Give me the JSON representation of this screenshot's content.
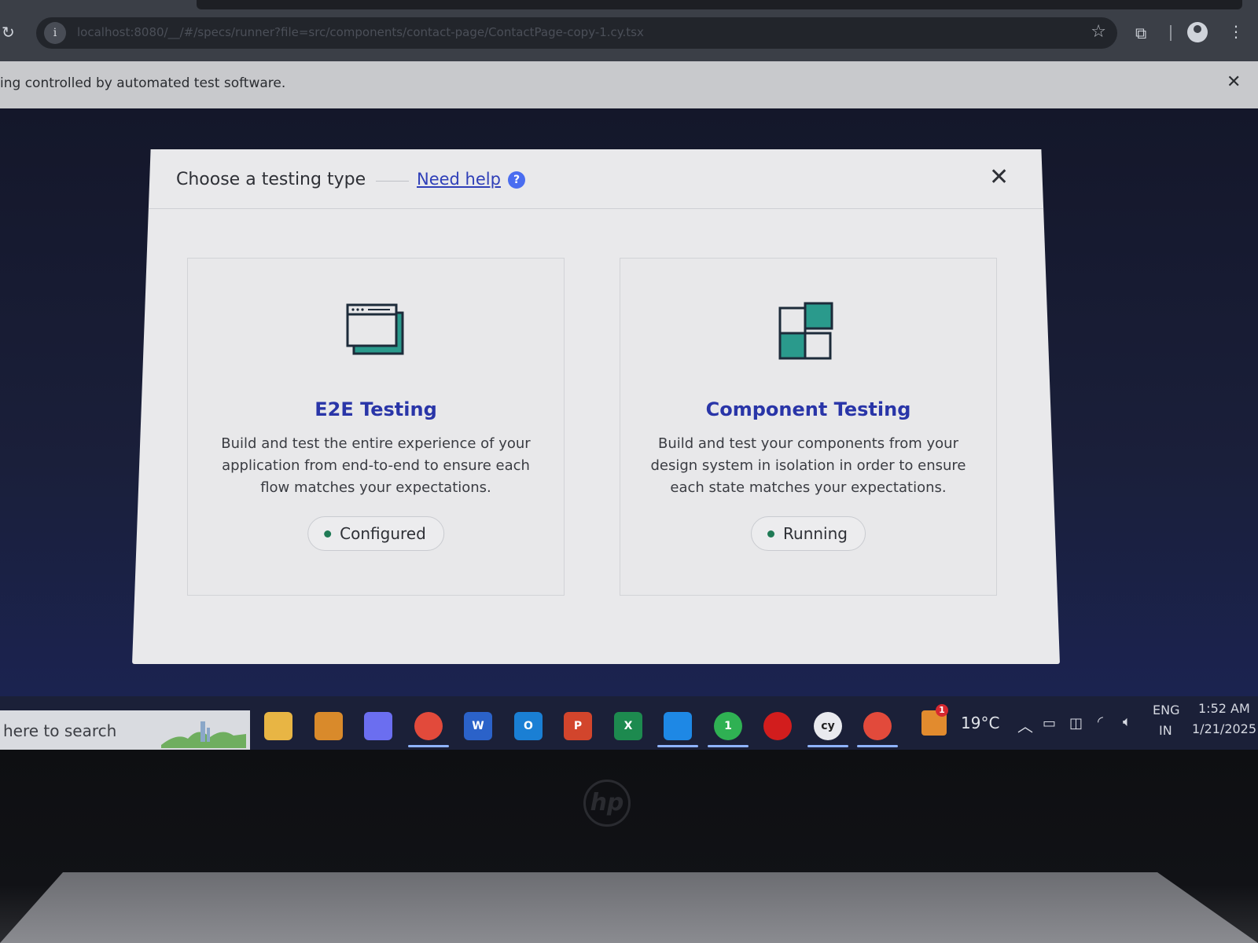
{
  "browser": {
    "url": "localhost:8080/__/#/specs/runner?file=src/components/contact-page/ContactPage-copy-1.cy.tsx",
    "automation_notice": "ing controlled by automated test software.",
    "automation_close": "✕"
  },
  "modal": {
    "title": "Choose a testing type",
    "help_link": "Need help",
    "help_icon_glyph": "?",
    "close_glyph": "✕",
    "cards": [
      {
        "title": "E2E Testing",
        "description": "Build and test the entire experience of your application from end-to-end to ensure each flow matches your expectations.",
        "status": "Configured",
        "icon": "browser-window-icon"
      },
      {
        "title": "Component Testing",
        "description": "Build and test your components from your design system in isolation in order to ensure each state matches your expectations.",
        "status": "Running",
        "icon": "component-blocks-icon"
      }
    ]
  },
  "taskbar": {
    "search_text": "here to search",
    "apps": [
      {
        "name": "file-explorer-icon",
        "label": "",
        "color": "#e8b544"
      },
      {
        "name": "notes-app-icon",
        "label": "",
        "color": "#d98a2b"
      },
      {
        "name": "copilot-icon",
        "label": "",
        "color": "#6b6ef0"
      },
      {
        "name": "chrome-icon",
        "label": "",
        "color": "#e24a3b"
      },
      {
        "name": "word-icon",
        "label": "W",
        "color": "#2b62c9"
      },
      {
        "name": "outlook-icon",
        "label": "O",
        "color": "#1a7fd4"
      },
      {
        "name": "powerpoint-icon",
        "label": "P",
        "color": "#d2452c"
      },
      {
        "name": "excel-icon",
        "label": "X",
        "color": "#1d8a4f"
      },
      {
        "name": "vscode-icon",
        "label": "",
        "color": "#1e88e5"
      },
      {
        "name": "whatsapp-icon",
        "label": "1",
        "color": "#2fb153"
      },
      {
        "name": "record-icon",
        "label": "",
        "color": "#d21d1d"
      },
      {
        "name": "cypress-icon",
        "label": "cy",
        "color": "#e9eaee"
      },
      {
        "name": "chrome-icon-2",
        "label": "",
        "color": "#e24a3b"
      }
    ],
    "weather_badge": "1",
    "temperature": "19°C",
    "language_top": "ENG",
    "language_bottom": "IN",
    "time": "1:52 AM",
    "date": "1/21/2025"
  },
  "bezel": {
    "logo": "hp"
  }
}
